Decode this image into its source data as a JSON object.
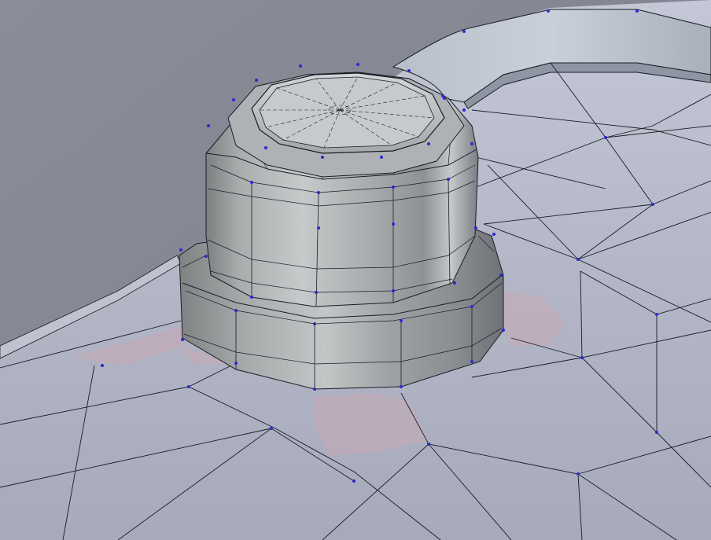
{
  "colors": {
    "background": "#8c8e9a",
    "surface": "#b8bcc9",
    "surface_dark": "#9ea2b1",
    "edge": "#1a1c24",
    "vertex": "#2a2ad0",
    "shadow": "#c9a9b6"
  }
}
